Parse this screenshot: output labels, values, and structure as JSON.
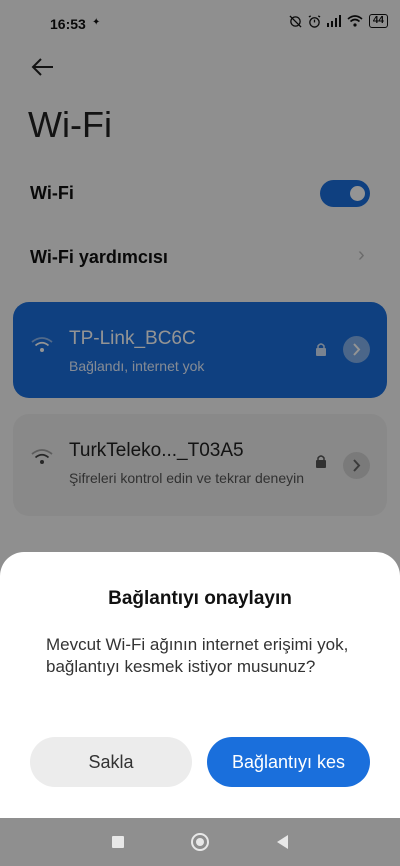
{
  "status_bar": {
    "time": "16:53",
    "battery": "44",
    "icons": [
      "notification-icon",
      "alarm-off-icon",
      "alarm-icon",
      "signal-icon",
      "wifi-icon",
      "battery-icon"
    ]
  },
  "header": {
    "back_icon": "arrow-left-icon",
    "title": "Wi-Fi"
  },
  "settings": {
    "wifi_label": "Wi-Fi",
    "wifi_enabled": true,
    "assistant_label": "Wi-Fi yardımcısı"
  },
  "networks": [
    {
      "name": "TP-Link_BC6C",
      "status": "Bağlandı, internet yok",
      "secured": true,
      "connected": true
    },
    {
      "name": "TurkTeleko..._T03A5",
      "status": "Şifreleri kontrol edin ve tekrar deneyin",
      "secured": true,
      "connected": false
    }
  ],
  "dialog": {
    "title": "Bağlantıyı onaylayın",
    "message": "Mevcut Wi-Fi ağının internet erişimi yok, bağlantıyı kesmek istiyor musunuz?",
    "keep_label": "Sakla",
    "disconnect_label": "Bağlantıyı kes"
  },
  "colors": {
    "accent": "#1a6fdc",
    "background": "#f7f7f7",
    "card_inactive": "#ececec"
  },
  "nav_bar": {
    "icons": [
      "recents-icon",
      "home-icon",
      "back-triangle-icon"
    ]
  }
}
